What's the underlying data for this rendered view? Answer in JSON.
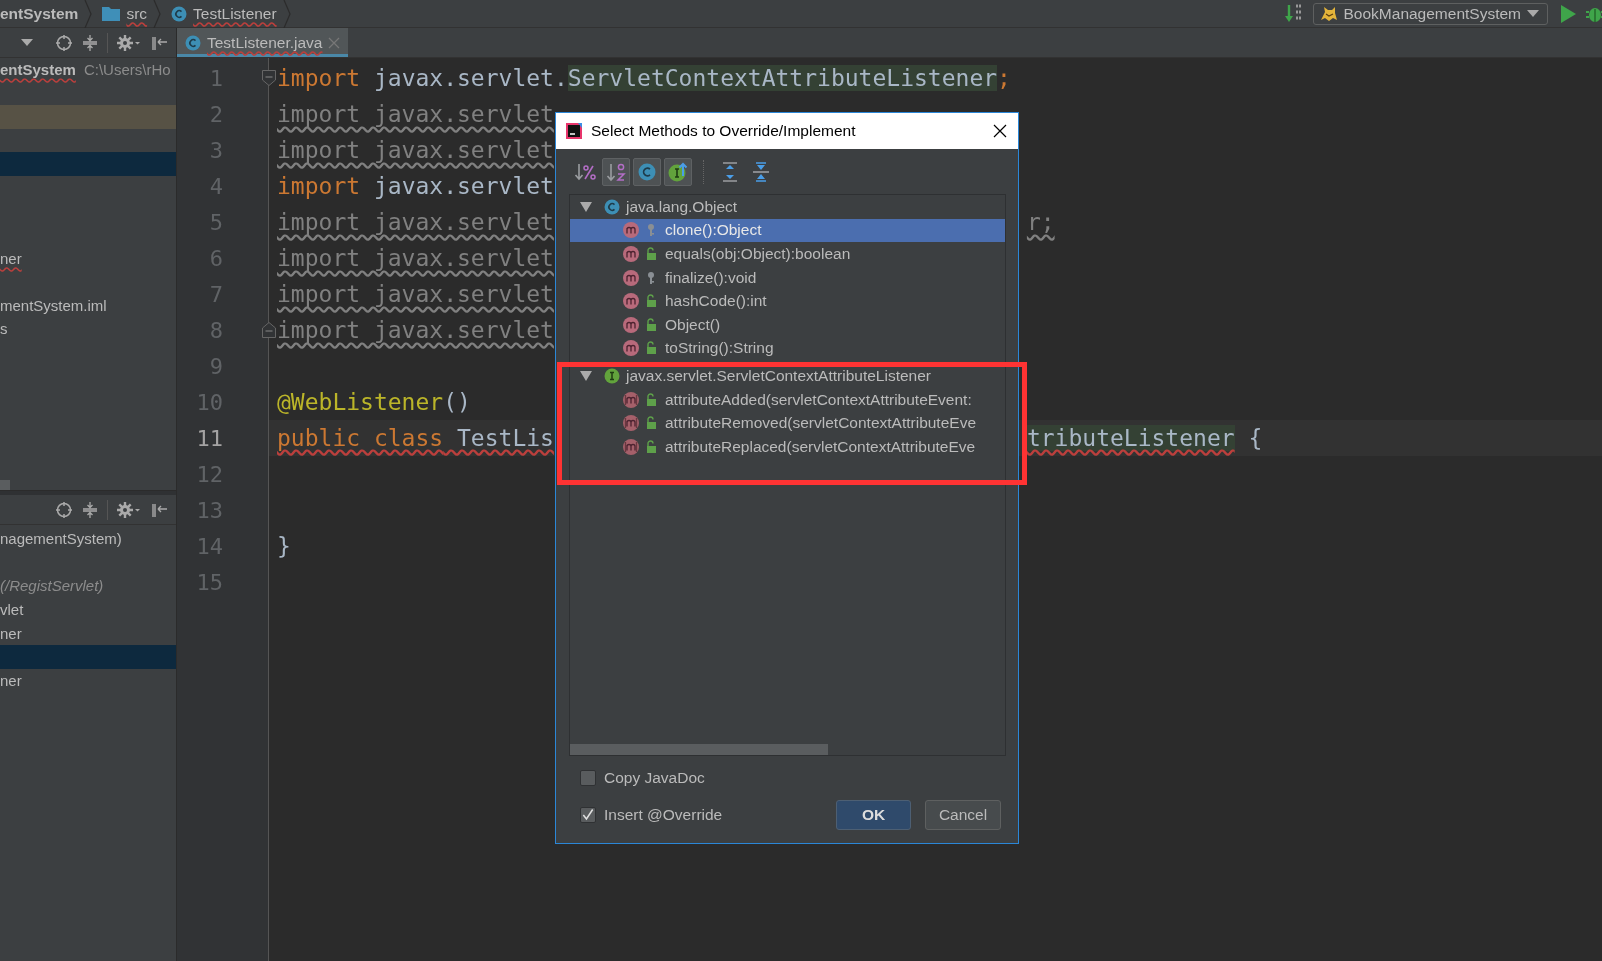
{
  "breadcrumb": [
    {
      "text": "entSystem",
      "kind": "project",
      "error": false
    },
    {
      "text": "src",
      "kind": "folder",
      "error": true
    },
    {
      "text": "TestListener",
      "kind": "class",
      "error": true
    }
  ],
  "run_config": {
    "label": "BookManagementSystem"
  },
  "editor_tabs": [
    {
      "label": "TestListener.java",
      "selected": true,
      "error": true
    }
  ],
  "project_tree": {
    "rows": [
      {
        "text": "entSystem",
        "path": "C:\\Users\\rHo",
        "selected": false,
        "highlighted": false,
        "error": true
      },
      {
        "selected": false,
        "highlighted": false
      },
      {
        "selected": false,
        "highlighted": true
      },
      {
        "selected": false,
        "highlighted": false
      },
      {
        "selected": true,
        "highlighted": false
      },
      {
        "selected": false,
        "highlighted": false
      },
      {
        "selected": false,
        "highlighted": false
      },
      {
        "selected": false,
        "highlighted": false
      },
      {
        "text": "ner",
        "selected": false,
        "highlighted": false,
        "error": true
      },
      {
        "selected": false,
        "highlighted": false
      },
      {
        "text": "mentSystem.iml",
        "selected": false,
        "highlighted": false,
        "error": false
      },
      {
        "text": "s",
        "selected": false,
        "highlighted": false,
        "error": false
      }
    ]
  },
  "structure_tree": {
    "rows": [
      {
        "text": "nagementSystem)",
        "selected": false,
        "italic": false
      },
      {
        "selected": false
      },
      {
        "text": "(/RegistServlet)",
        "selected": false,
        "italic": true
      },
      {
        "text": "vlet",
        "selected": false,
        "italic": false
      },
      {
        "text": "ner",
        "selected": false,
        "italic": false
      },
      {
        "selected": true
      },
      {
        "text": "ner",
        "selected": false,
        "italic": false
      }
    ]
  },
  "code_lines": [
    {
      "number": "1",
      "kind": "fold-start",
      "current": false,
      "left": [
        {
          "text": "import",
          "kind": "kw"
        },
        {
          "text": " javax.servlet.",
          "kind": "txt"
        },
        {
          "text": "ServletContextAttributeListener",
          "kind": "ref"
        },
        {
          "text": ";",
          "kind": "kw"
        }
      ]
    },
    {
      "number": "2",
      "kind": "plain",
      "current": false,
      "left": [
        {
          "text": "import javax.servlet",
          "kind": "unused"
        }
      ]
    },
    {
      "number": "3",
      "kind": "plain",
      "current": false,
      "left": [
        {
          "text": "import javax.servlet",
          "kind": "unused"
        }
      ]
    },
    {
      "number": "4",
      "kind": "plain",
      "current": false,
      "left": [
        {
          "text": "import",
          "kind": "kw"
        },
        {
          "text": " javax.servlet",
          "kind": "txt"
        }
      ]
    },
    {
      "number": "5",
      "kind": "plain",
      "current": false,
      "left": [
        {
          "text": "import javax.servlet",
          "kind": "unused"
        }
      ],
      "right": [
        {
          "text": "r;",
          "kind": "unused"
        }
      ]
    },
    {
      "number": "6",
      "kind": "plain",
      "current": false,
      "left": [
        {
          "text": "import javax.servlet",
          "kind": "unused"
        }
      ]
    },
    {
      "number": "7",
      "kind": "plain",
      "current": false,
      "left": [
        {
          "text": "import javax.servlet",
          "kind": "unused"
        }
      ]
    },
    {
      "number": "8",
      "kind": "fold-end",
      "current": false,
      "left": [
        {
          "text": "import javax.servlet",
          "kind": "unused"
        }
      ]
    },
    {
      "number": "9",
      "kind": "plain",
      "current": false
    },
    {
      "number": "10",
      "kind": "plain",
      "current": false,
      "left": [
        {
          "text": "@WebListener",
          "kind": "ann"
        },
        {
          "text": "()",
          "kind": "txt"
        }
      ]
    },
    {
      "number": "11",
      "kind": "plain",
      "current": true,
      "left": [
        {
          "text": "public class",
          "kind": "kw-err"
        },
        {
          "text": " TestLis",
          "kind": "txt-err"
        }
      ],
      "right": [
        {
          "text": "tributeListener",
          "kind": "ref-err"
        },
        {
          "text": " {",
          "kind": "txt"
        }
      ]
    },
    {
      "number": "12",
      "kind": "plain",
      "current": false
    },
    {
      "number": "13",
      "kind": "plain",
      "current": false
    },
    {
      "number": "14",
      "kind": "plain",
      "current": false,
      "left": [
        {
          "text": "}",
          "kind": "txt"
        }
      ]
    },
    {
      "number": "15",
      "kind": "plain",
      "current": false
    }
  ],
  "dialog": {
    "title": "Select Methods to Override/Implement",
    "toolbar": [
      {
        "kind": "sort-visibility",
        "selected": false
      },
      {
        "kind": "sort-alpha",
        "selected": true
      },
      {
        "kind": "show-classes",
        "selected": true
      },
      {
        "kind": "show-interfaces",
        "selected": true
      },
      {
        "kind": "expand-all",
        "selected": false
      },
      {
        "kind": "collapse-all",
        "selected": false
      }
    ],
    "tree": [
      {
        "name": "java.lang.Object",
        "kind": "class",
        "expanded": true,
        "children": [
          {
            "name": "clone():Object",
            "kind": "protected",
            "abstract": false,
            "selected": true
          },
          {
            "name": "equals(obj:Object):boolean",
            "kind": "public",
            "abstract": false,
            "selected": false
          },
          {
            "name": "finalize():void",
            "kind": "protected",
            "abstract": false,
            "selected": false
          },
          {
            "name": "hashCode():int",
            "kind": "public",
            "abstract": false,
            "selected": false
          },
          {
            "name": "Object()",
            "kind": "public",
            "abstract": false,
            "selected": false
          },
          {
            "name": "toString():String",
            "kind": "public",
            "abstract": false,
            "selected": false
          }
        ]
      },
      {
        "name": "javax.servlet.ServletContextAttributeListener",
        "kind": "interface",
        "expanded": true,
        "children": [
          {
            "name": "attributeAdded(servletContextAttributeEvent:",
            "kind": "public",
            "abstract": true,
            "selected": false
          },
          {
            "name": "attributeRemoved(servletContextAttributeEve",
            "kind": "public",
            "abstract": true,
            "selected": false
          },
          {
            "name": "attributeReplaced(servletContextAttributeEve",
            "kind": "public",
            "abstract": true,
            "selected": false
          }
        ]
      }
    ],
    "options": [
      {
        "label": "Copy JavaDoc",
        "checked": false
      },
      {
        "label": "Insert @Override",
        "checked": true
      }
    ],
    "buttons": [
      {
        "label": "OK",
        "kind": "primary"
      },
      {
        "label": "Cancel",
        "kind": "secondary"
      }
    ]
  }
}
